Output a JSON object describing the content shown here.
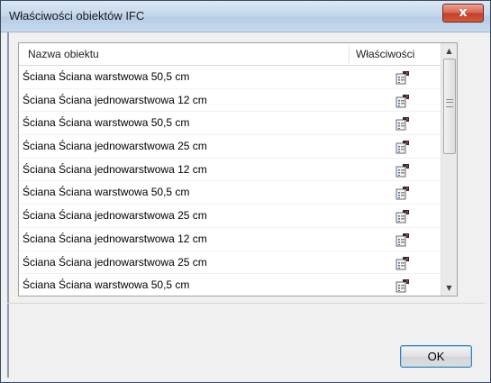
{
  "window": {
    "title": "Właściwości obiektów IFC",
    "close_glyph": "x"
  },
  "list": {
    "columns": {
      "name": "Nazwa obiektu",
      "properties": "Właściwości"
    },
    "rows": [
      {
        "name": "Ściana Ściana warstwowa 50,5 cm",
        "icon": "properties-icon"
      },
      {
        "name": "Ściana Ściana jednowarstwowa 12 cm",
        "icon": "properties-icon"
      },
      {
        "name": "Ściana Ściana warstwowa 50,5 cm",
        "icon": "properties-icon"
      },
      {
        "name": "Ściana Ściana jednowarstwowa 25 cm",
        "icon": "properties-icon"
      },
      {
        "name": "Ściana Ściana jednowarstwowa 12 cm",
        "icon": "properties-icon"
      },
      {
        "name": "Ściana Ściana warstwowa 50,5 cm",
        "icon": "properties-icon"
      },
      {
        "name": "Ściana Ściana jednowarstwowa 25 cm",
        "icon": "properties-icon"
      },
      {
        "name": "Ściana Ściana jednowarstwowa 12 cm",
        "icon": "properties-icon"
      },
      {
        "name": "Ściana Ściana jednowarstwowa 25 cm",
        "icon": "properties-icon"
      },
      {
        "name": "Ściana Ściana warstwowa 50,5 cm",
        "icon": "properties-icon"
      }
    ]
  },
  "buttons": {
    "ok": "OK"
  },
  "colors": {
    "close": "#c3402a",
    "title_bar": "#c5d8ec",
    "ok_border": "#3c7fb1"
  }
}
